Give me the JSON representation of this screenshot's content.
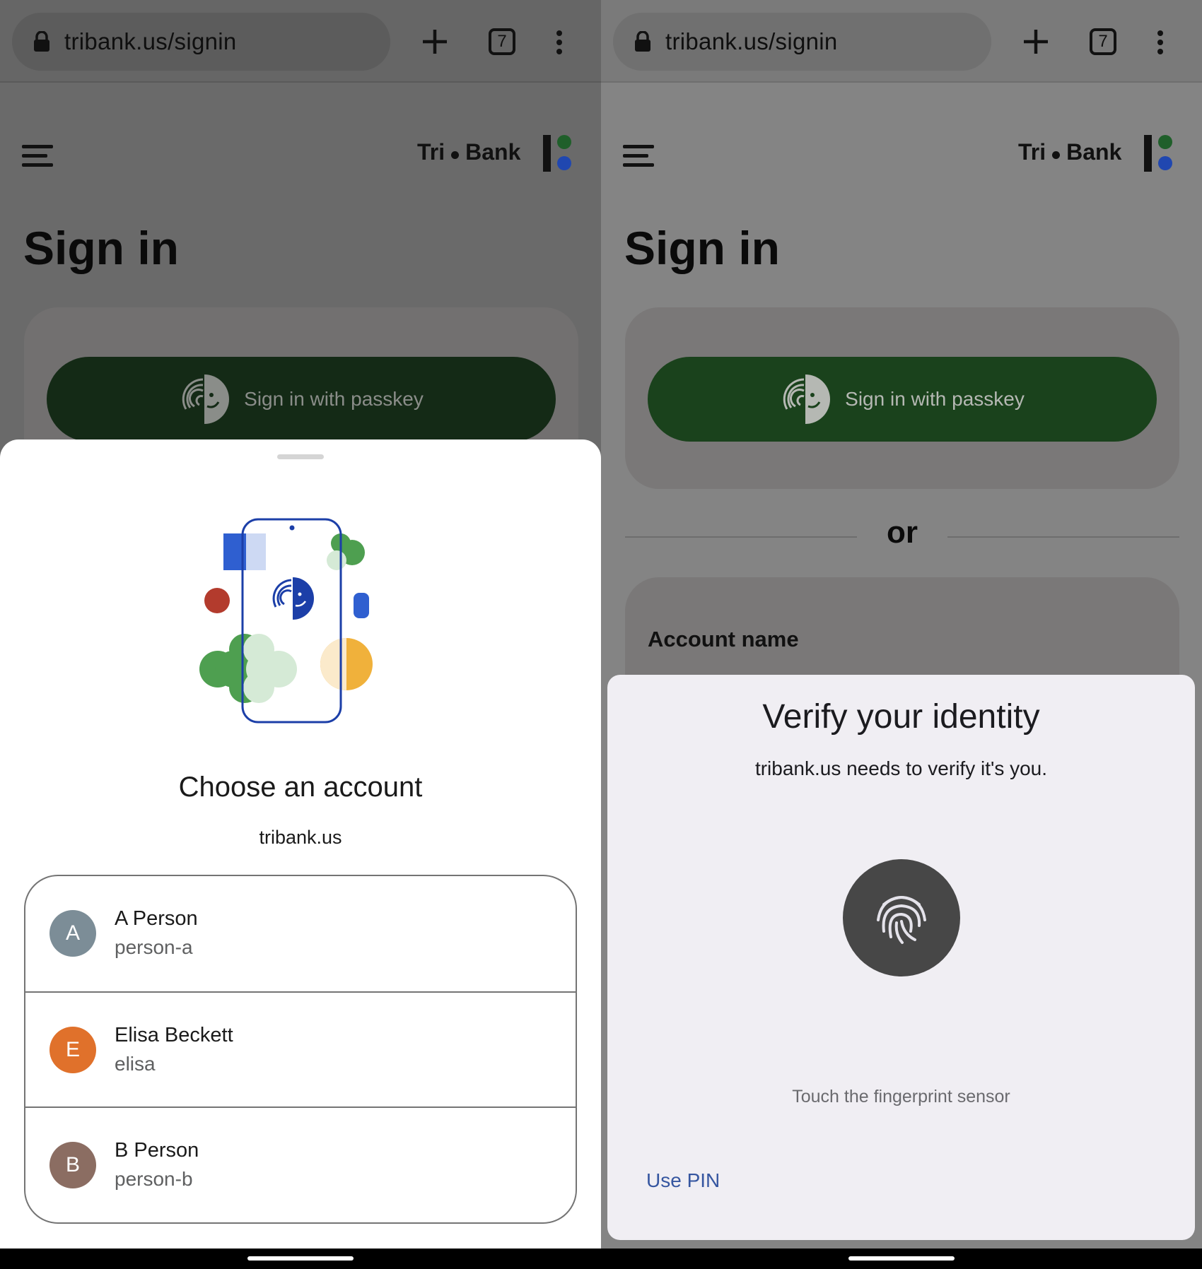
{
  "left": {
    "browser": {
      "url": "tribank.us/signin",
      "tab_count": "7"
    },
    "site": {
      "brand_left": "Tri",
      "brand_right": "Bank",
      "title": "Sign in",
      "passkey_button": "Sign in with passkey"
    },
    "sheet": {
      "title": "Choose an account",
      "subtitle": "tribank.us",
      "accounts": [
        {
          "initial": "A",
          "name": "A Person",
          "username": "person-a",
          "color": "#7c8d97"
        },
        {
          "initial": "E",
          "name": "Elisa Beckett",
          "username": "elisa",
          "color": "#e0712b"
        },
        {
          "initial": "B",
          "name": "B Person",
          "username": "person-b",
          "color": "#8b6d62"
        }
      ]
    }
  },
  "right": {
    "browser": {
      "url": "tribank.us/signin",
      "tab_count": "7"
    },
    "site": {
      "brand_left": "Tri",
      "brand_right": "Bank",
      "title": "Sign in",
      "passkey_button": "Sign in with passkey",
      "or": "or",
      "account_label": "Account name"
    },
    "dialog": {
      "title": "Verify your identity",
      "subtitle": "tribank.us needs to verify it's you.",
      "hint": "Touch the fingerprint sensor",
      "use_pin": "Use PIN"
    }
  },
  "icons": {
    "lock": "lock-icon",
    "new_tab": "plus-icon",
    "tab_switcher": "tab-count-icon",
    "menu": "more-vert-icon",
    "hamburger": "hamburger-menu-icon",
    "passkey": "passkey-icon",
    "fingerprint": "fingerprint-icon"
  },
  "colors": {
    "passkey_button": "#1a421c",
    "link": "#3656a0",
    "brand_green": "#1f5f2a",
    "brand_blue": "#2047b0"
  }
}
